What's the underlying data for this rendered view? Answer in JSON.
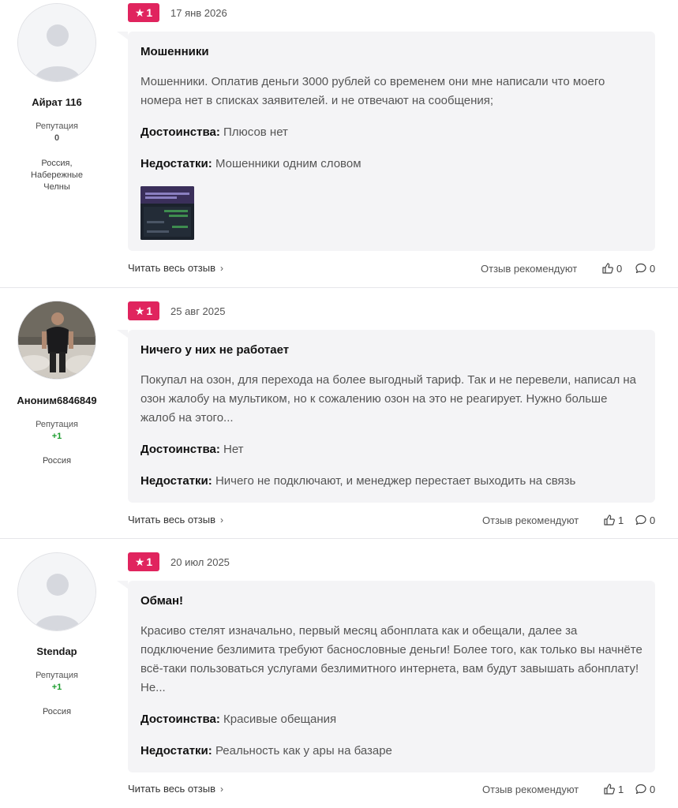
{
  "reviews": [
    {
      "author": {
        "name": "Айрат 116",
        "reputation_label": "Репутация",
        "reputation_value": "0",
        "location": "Россия, Набережные Челны",
        "avatar": "default-avatar-icon"
      },
      "rating": "1",
      "date": "17 янв 2026",
      "title": "Мошенники",
      "text": "Мошенники. Оплатив деньги 3000 рублей со временем они мне написали что моего номера нет в списках заявителей. и не отвечают на сообщения;",
      "pros_label": "Достоинства:",
      "pros": "Плюсов нет",
      "cons_label": "Недостатки:",
      "cons": "Мошенники одним словом",
      "read_more": "Читать весь отзыв",
      "recommend_label": "Отзыв рекомендуют",
      "likes": "0",
      "comments": "0"
    },
    {
      "author": {
        "name": "Аноним6846849",
        "reputation_label": "Репутация",
        "reputation_value": "+1",
        "location": "Россия",
        "avatar": "user-photo"
      },
      "rating": "1",
      "date": "25 авг 2025",
      "title": "Ничего у них не работает",
      "text": "Покупал на озон, для перехода на более выгодный тариф. Так и не перевели, написал на озон жалобу на мультиком, но к сожалению озон на это не реагирует. Нужно больше жалоб на этого...",
      "pros_label": "Достоинства:",
      "pros": "Нет",
      "cons_label": "Недостатки:",
      "cons": "Ничего не подключают, и менеджер перестает выходить на связь",
      "read_more": "Читать весь отзыв",
      "recommend_label": "Отзыв рекомендуют",
      "likes": "1",
      "comments": "0"
    },
    {
      "author": {
        "name": "Stendap",
        "reputation_label": "Репутация",
        "reputation_value": "+1",
        "location": "Россия",
        "avatar": "default-avatar-icon"
      },
      "rating": "1",
      "date": "20 июл 2025",
      "title": "Обман!",
      "text": "Красиво стелят изначально, первый месяц абонплата как и обещали, далее за подключение безлимита требуют баснословные деньги! Более того, как только вы начнёте всё-таки пользоваться услугами безлимитного интернета, вам будут завышать абонплату! Не...",
      "pros_label": "Достоинства:",
      "pros": "Красивые обещания",
      "cons_label": "Недостатки:",
      "cons": "Реальность как у ары на базаре",
      "read_more": "Читать весь отзыв",
      "recommend_label": "Отзыв рекомендуют",
      "likes": "1",
      "comments": "0"
    }
  ],
  "colors": {
    "badge": "#e0245e",
    "card_bg": "#f4f4f6",
    "positive_reputation": "#1a9c2c"
  }
}
